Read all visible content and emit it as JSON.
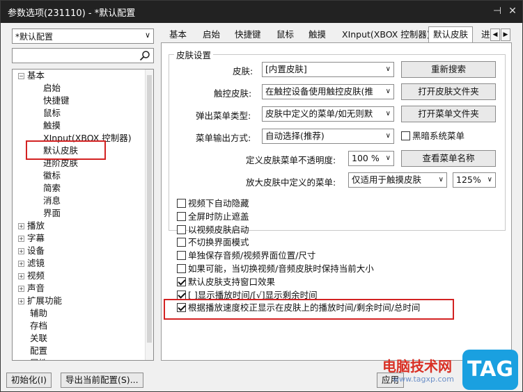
{
  "window": {
    "title": "参数选项(231110) - *默认配置",
    "pin_glyph": "⊣",
    "close_glyph": "✕"
  },
  "left": {
    "preset": "*默认配置",
    "search_placeholder": "",
    "tree": [
      {
        "label": "基本",
        "exp": "−",
        "level": 0
      },
      {
        "label": "启始",
        "level": 1
      },
      {
        "label": "快捷键",
        "level": 1
      },
      {
        "label": "鼠标",
        "level": 1
      },
      {
        "label": "触摸",
        "level": 1
      },
      {
        "label": "XInput(XBOX 控制器)",
        "level": 1
      },
      {
        "label": "默认皮肤",
        "level": 1
      },
      {
        "label": "进阶皮肤",
        "level": 1
      },
      {
        "label": "徽标",
        "level": 1
      },
      {
        "label": "简索",
        "level": 1
      },
      {
        "label": "消息",
        "level": 1
      },
      {
        "label": "界面",
        "level": 1
      },
      {
        "label": "播放",
        "exp": "+",
        "level": 0
      },
      {
        "label": "字幕",
        "exp": "+",
        "level": 0
      },
      {
        "label": "设备",
        "exp": "+",
        "level": 0
      },
      {
        "label": "滤镜",
        "exp": "+",
        "level": 0
      },
      {
        "label": "视频",
        "exp": "+",
        "level": 0
      },
      {
        "label": "声音",
        "exp": "+",
        "level": 0
      },
      {
        "label": "扩展功能",
        "exp": "+",
        "level": 0
      },
      {
        "label": "辅助",
        "level": 0
      },
      {
        "label": "存档",
        "level": 0
      },
      {
        "label": "关联",
        "level": 0
      },
      {
        "label": "配置",
        "level": 0
      },
      {
        "label": "属性",
        "level": 0
      }
    ]
  },
  "tabs": [
    "基本",
    "启始",
    "快捷键",
    "鼠标",
    "触摸",
    "XInput(XBOX 控制器)",
    "默认皮肤",
    "进"
  ],
  "active_tab": 6,
  "skin_settings": {
    "group_title": "皮肤设置",
    "skin_label": "皮肤:",
    "skin_value": "[内置皮肤]",
    "touch_skin_label": "触控皮肤:",
    "touch_skin_value": "在触控设备使用触控皮肤(推",
    "popup_menu_label": "弹出菜单类型:",
    "popup_menu_value": "皮肤中定义的菜单/如无则默",
    "menu_output_label": "菜单输出方式:",
    "menu_output_value": "自动选择(推荐)",
    "opacity_label": "定义皮肤菜单不透明度:",
    "opacity_value": "100 %",
    "zoom_menu_label": "放大皮肤中定义的菜单:",
    "zoom_menu_value": "仅适用于触摸皮肤",
    "zoom_value": "125%",
    "btn_research": "重新搜索",
    "btn_open_skin_folder": "打开皮肤文件夹",
    "btn_open_menu_folder": "打开菜单文件夹",
    "btn_view_menu_name": "查看菜单名称",
    "dark_menu_label": "黑暗系统菜单"
  },
  "options": [
    {
      "label": "视频下自动隐藏",
      "checked": false
    },
    {
      "label": "全屏时防止遮盖",
      "checked": false
    },
    {
      "label": "以视频皮肤启动",
      "checked": false
    },
    {
      "label": "不切换界面模式",
      "checked": false
    },
    {
      "label": "单独保存音频/视频界面位置/尺寸",
      "checked": false
    },
    {
      "label": "如果可能，当切换视频/音频皮肤时保持当前大小",
      "checked": false
    },
    {
      "label": "默认皮肤支持窗口效果",
      "checked": true
    },
    {
      "label": "[ ]显示播放时间/[√]显示剩余时间",
      "checked": true
    },
    {
      "label": "根据播放速度校正显示在皮肤上的播放时间/剩余时间/总时间",
      "checked": true
    }
  ],
  "bottom": {
    "init_btn": "初始化(I)",
    "export_btn": "导出当前配置(S)...",
    "apply_btn": "应用"
  },
  "watermark": {
    "site_name": "电脑技术网",
    "url": "www.tagxp.com",
    "logo": "TAG"
  }
}
